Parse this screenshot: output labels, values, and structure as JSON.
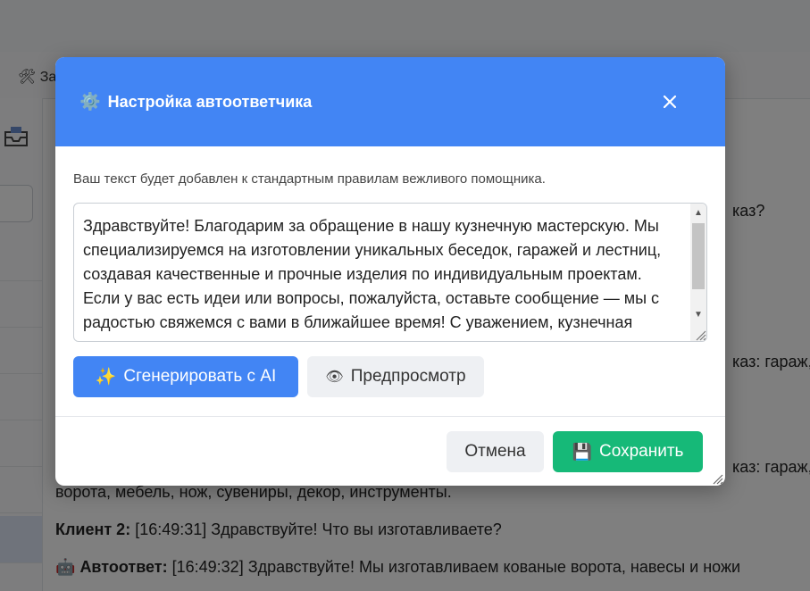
{
  "app": {
    "toolbar_label": "🛠 За",
    "sidebar_icon": "inbox-tray-icon",
    "chat": {
      "fragment_1": "каз?",
      "fragment_2": "каз: гараж,",
      "fragment_3": "каз: гараж,",
      "line_cont": "ворота, мебель, нож, сувениры, декор, инструменты.",
      "client2_name": "Клиент 2:",
      "client2_text": " [16:49:31] Здравствуйте! Что вы изготавливаете?",
      "auto_icon": "robot-icon",
      "auto_name": "Автоответ:",
      "auto_text": " [16:49:32] Здравствуйте! Мы изготавливаем кованые ворота, навесы и ножи"
    }
  },
  "modal": {
    "title": "Настройка автоответчика",
    "title_icon": "gear-icon",
    "close_label": "✕",
    "hint": "Ваш текст будет добавлен к стандартным правилам вежливого помощника.",
    "textarea_value": "Здравствуйте! Благодарим за обращение в нашу кузнечную мастерскую. Мы специализируемся на изготовлении уникальных беседок, гаражей и лестниц, создавая качественные и прочные изделия по индивидуальным проектам. Если у вас есть идеи или вопросы, пожалуйста, оставьте сообщение — мы с радостью свяжемся с вами в ближайшее время! С уважением, кузнечная мастерская.",
    "ai_button": {
      "icon": "✨",
      "label": "Сгенерировать с AI"
    },
    "preview_button": {
      "icon": "👁",
      "label": "Предпросмотр"
    },
    "cancel_label": "Отмена",
    "save_button": {
      "icon": "💾",
      "label": "Сохранить"
    }
  },
  "colors": {
    "header": "#4285f4",
    "ai_button": "#4285f4",
    "save_button": "#16b978"
  }
}
